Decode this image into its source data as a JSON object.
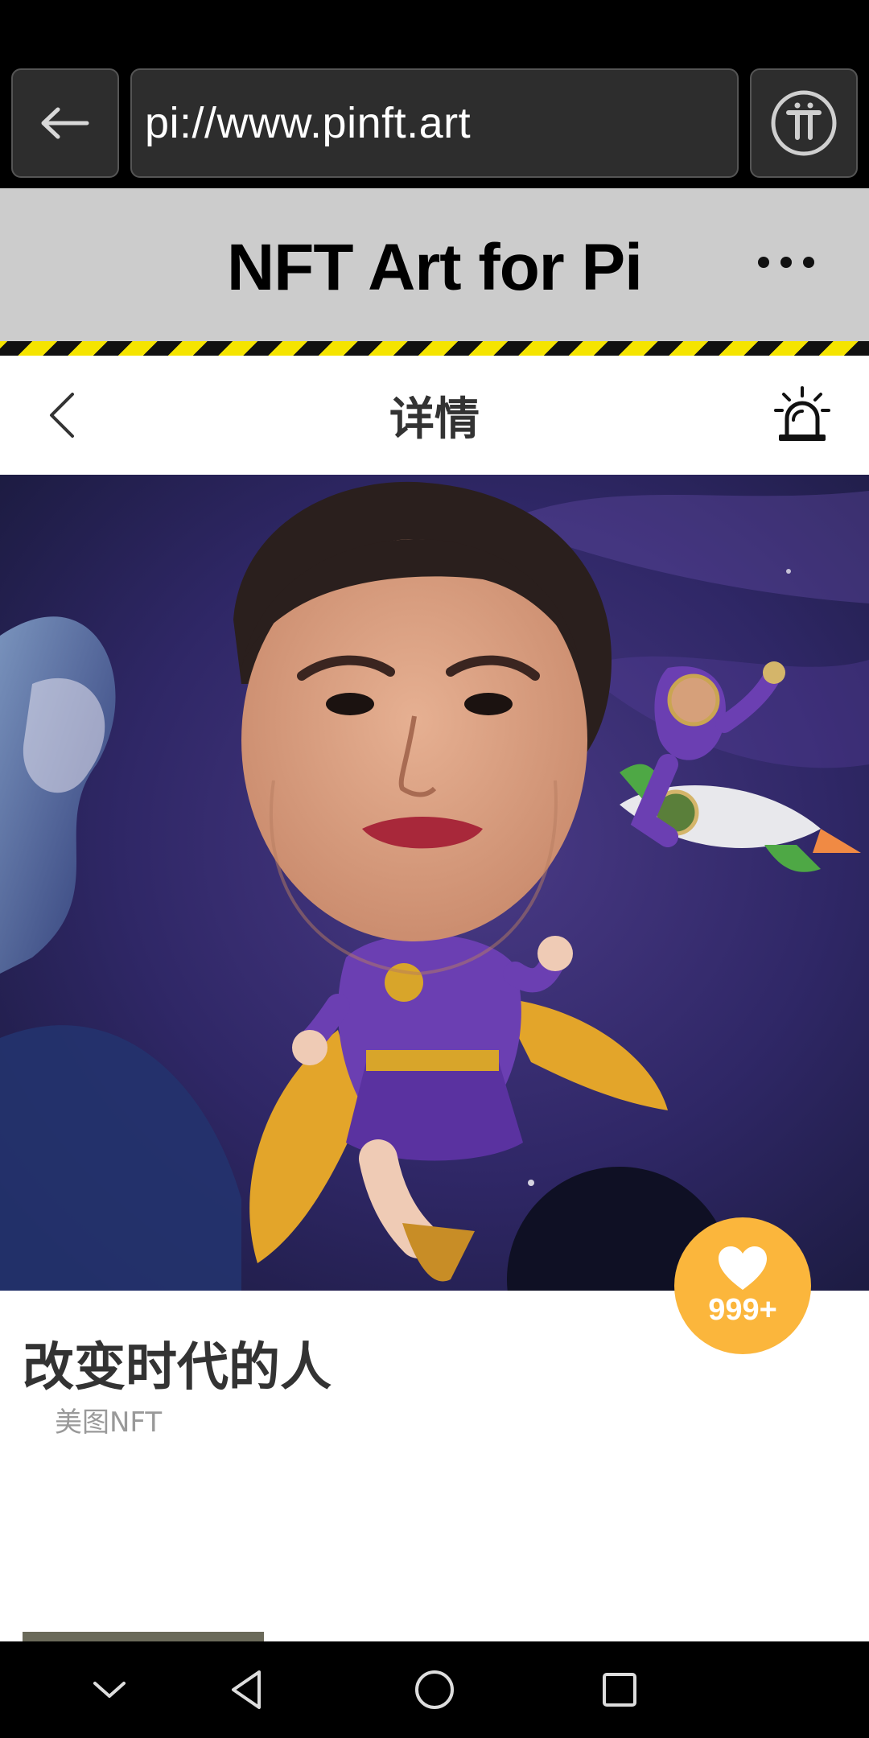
{
  "browser": {
    "url": "pi://www.pinft.art",
    "back_icon": "arrow-left-icon",
    "menu_icon": "pi-logo-icon"
  },
  "app": {
    "title": "NFT Art for Pi",
    "more_icon": "more-dots-icon"
  },
  "detail": {
    "nav_title": "详情",
    "back_icon": "chevron-left-icon",
    "report_icon": "alarm-icon"
  },
  "artwork": {
    "title": "改变时代的人",
    "category": "美图NFT",
    "likes": "999+",
    "image_subject": "cartoon superheroine in purple costume with golden cape flying in space, astronaut riding a rocket"
  },
  "system_nav": {
    "buttons": [
      "hide-keyboard-icon",
      "back-triangle-icon",
      "home-circle-icon",
      "recents-square-icon"
    ]
  },
  "colors": {
    "header_bg": "#cccccc",
    "stripe_yellow": "#f5e400",
    "like_badge": "#fbb63c",
    "browser_bg": "#2d2d2d"
  }
}
